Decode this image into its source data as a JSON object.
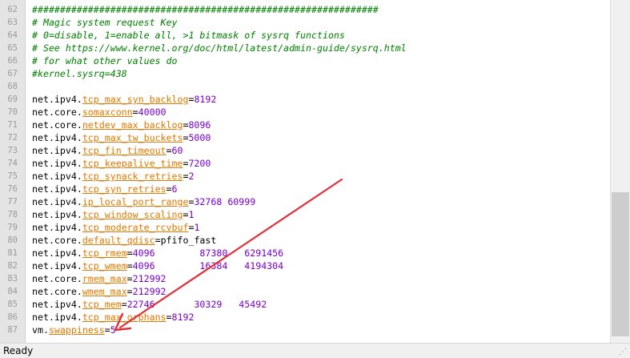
{
  "editor": {
    "lines": [
      {
        "n": "62",
        "parts": [
          {
            "t": "##############################################################",
            "c": "comment"
          }
        ]
      },
      {
        "n": "63",
        "parts": [
          {
            "t": "# Magic system request Key",
            "c": "comment"
          }
        ]
      },
      {
        "n": "64",
        "parts": [
          {
            "t": "# 0=disable, 1=enable all, >1 bitmask of sysrq functions",
            "c": "comment"
          }
        ]
      },
      {
        "n": "65",
        "parts": [
          {
            "t": "# See https://www.kernel.org/doc/html/latest/admin-guide/sysrq.html",
            "c": "comment"
          }
        ]
      },
      {
        "n": "66",
        "parts": [
          {
            "t": "# for what other values do",
            "c": "comment"
          }
        ]
      },
      {
        "n": "67",
        "parts": [
          {
            "t": "#kernel.sysrq=438",
            "c": "comment"
          }
        ]
      },
      {
        "n": "68",
        "parts": []
      },
      {
        "n": "69",
        "parts": [
          {
            "t": "net.ipv4.",
            "c": "plain"
          },
          {
            "t": "tcp_max_syn_backlog",
            "c": "key"
          },
          {
            "t": "=",
            "c": "plain"
          },
          {
            "t": "8192",
            "c": "num"
          }
        ]
      },
      {
        "n": "70",
        "parts": [
          {
            "t": "net.core.",
            "c": "plain"
          },
          {
            "t": "somaxconn",
            "c": "key"
          },
          {
            "t": "=",
            "c": "plain"
          },
          {
            "t": "40000",
            "c": "num"
          }
        ]
      },
      {
        "n": "71",
        "parts": [
          {
            "t": "net.core.",
            "c": "plain"
          },
          {
            "t": "netdev_max_backlog",
            "c": "key"
          },
          {
            "t": "=",
            "c": "plain"
          },
          {
            "t": "8096",
            "c": "num"
          }
        ]
      },
      {
        "n": "72",
        "parts": [
          {
            "t": "net.ipv4.",
            "c": "plain"
          },
          {
            "t": "tcp_max_tw_buckets",
            "c": "key"
          },
          {
            "t": "=",
            "c": "plain"
          },
          {
            "t": "5000",
            "c": "num"
          }
        ]
      },
      {
        "n": "73",
        "parts": [
          {
            "t": "net.ipv4.",
            "c": "plain"
          },
          {
            "t": "tcp_fin_timeout",
            "c": "key"
          },
          {
            "t": "=",
            "c": "plain"
          },
          {
            "t": "60",
            "c": "num"
          }
        ]
      },
      {
        "n": "74",
        "parts": [
          {
            "t": "net.ipv4.",
            "c": "plain"
          },
          {
            "t": "tcp_keepalive_time",
            "c": "key"
          },
          {
            "t": "=",
            "c": "plain"
          },
          {
            "t": "7200",
            "c": "num"
          }
        ]
      },
      {
        "n": "75",
        "parts": [
          {
            "t": "net.ipv4.",
            "c": "plain"
          },
          {
            "t": "tcp_synack_retries",
            "c": "key"
          },
          {
            "t": "=",
            "c": "plain"
          },
          {
            "t": "2",
            "c": "num"
          }
        ]
      },
      {
        "n": "76",
        "parts": [
          {
            "t": "net.ipv4.",
            "c": "plain"
          },
          {
            "t": "tcp_syn_retries",
            "c": "key"
          },
          {
            "t": "=",
            "c": "plain"
          },
          {
            "t": "6",
            "c": "num"
          }
        ]
      },
      {
        "n": "77",
        "parts": [
          {
            "t": "net.ipv4.",
            "c": "plain"
          },
          {
            "t": "ip_local_port_range",
            "c": "key"
          },
          {
            "t": "=",
            "c": "plain"
          },
          {
            "t": "32768 60999",
            "c": "num"
          }
        ]
      },
      {
        "n": "78",
        "parts": [
          {
            "t": "net.ipv4.",
            "c": "plain"
          },
          {
            "t": "tcp_window_scaling",
            "c": "key"
          },
          {
            "t": "=",
            "c": "plain"
          },
          {
            "t": "1",
            "c": "num"
          }
        ]
      },
      {
        "n": "79",
        "parts": [
          {
            "t": "net.ipv4.",
            "c": "plain"
          },
          {
            "t": "tcp_moderate_rcvbuf",
            "c": "key"
          },
          {
            "t": "=",
            "c": "plain"
          },
          {
            "t": "1",
            "c": "num"
          }
        ]
      },
      {
        "n": "80",
        "parts": [
          {
            "t": "net.core.",
            "c": "plain"
          },
          {
            "t": "default_qdisc",
            "c": "key"
          },
          {
            "t": "=",
            "c": "plain"
          },
          {
            "t": "pfifo_fast",
            "c": "plain"
          }
        ]
      },
      {
        "n": "81",
        "parts": [
          {
            "t": "net.ipv4.",
            "c": "plain"
          },
          {
            "t": "tcp_rmem",
            "c": "key"
          },
          {
            "t": "=",
            "c": "plain"
          },
          {
            "t": "4096        87380   6291456",
            "c": "num"
          }
        ]
      },
      {
        "n": "82",
        "parts": [
          {
            "t": "net.ipv4.",
            "c": "plain"
          },
          {
            "t": "tcp_wmem",
            "c": "key"
          },
          {
            "t": "=",
            "c": "plain"
          },
          {
            "t": "4096        16384   4194304",
            "c": "num"
          }
        ]
      },
      {
        "n": "83",
        "parts": [
          {
            "t": "net.core.",
            "c": "plain"
          },
          {
            "t": "rmem_max",
            "c": "key"
          },
          {
            "t": "=",
            "c": "plain"
          },
          {
            "t": "212992",
            "c": "num"
          }
        ]
      },
      {
        "n": "84",
        "parts": [
          {
            "t": "net.core.",
            "c": "plain"
          },
          {
            "t": "wmem_max",
            "c": "key"
          },
          {
            "t": "=",
            "c": "plain"
          },
          {
            "t": "212992",
            "c": "num"
          }
        ]
      },
      {
        "n": "85",
        "parts": [
          {
            "t": "net.ipv4.",
            "c": "plain"
          },
          {
            "t": "tcp_mem",
            "c": "key"
          },
          {
            "t": "=",
            "c": "plain"
          },
          {
            "t": "22746       30329   45492",
            "c": "num"
          }
        ]
      },
      {
        "n": "86",
        "parts": [
          {
            "t": "net.ipv4.",
            "c": "plain"
          },
          {
            "t": "tcp_max_orphans",
            "c": "key"
          },
          {
            "t": "=",
            "c": "plain"
          },
          {
            "t": "8192",
            "c": "num"
          }
        ]
      },
      {
        "n": "87",
        "parts": [
          {
            "t": "vm.",
            "c": "plain"
          },
          {
            "t": "swappiness",
            "c": "key"
          },
          {
            "t": "=",
            "c": "plain"
          },
          {
            "t": "5",
            "c": "num"
          }
        ]
      }
    ]
  },
  "status": {
    "text": "Ready"
  },
  "colors": {
    "comment": "#008000",
    "key": "#e07800",
    "number": "#7a00cc",
    "arrow": "#e0303a"
  }
}
